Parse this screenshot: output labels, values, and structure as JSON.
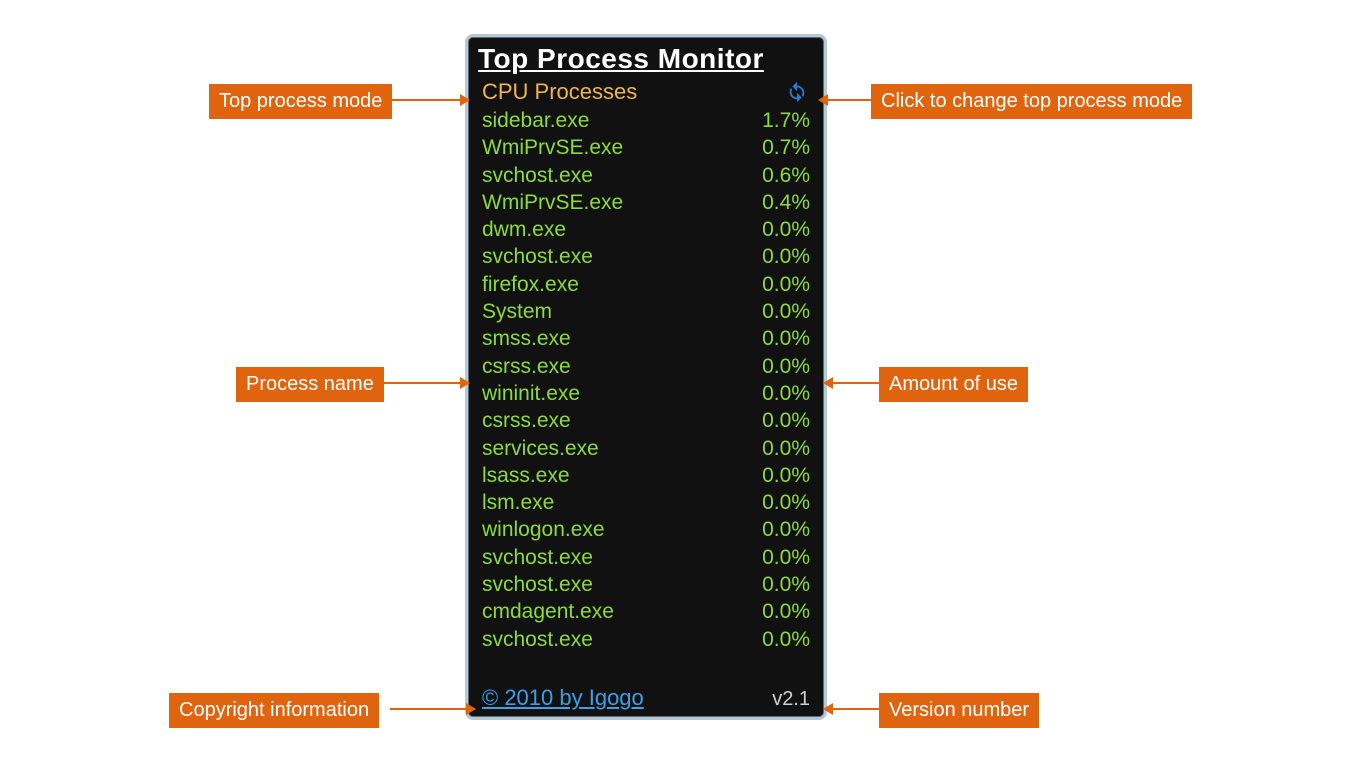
{
  "gadget": {
    "title": "Top Process Monitor",
    "mode_label": "CPU Processes",
    "refresh_icon": "refresh-icon",
    "processes": [
      {
        "name": "sidebar.exe",
        "value": "1.7%"
      },
      {
        "name": "WmiPrvSE.exe",
        "value": "0.7%"
      },
      {
        "name": "svchost.exe",
        "value": "0.6%"
      },
      {
        "name": "WmiPrvSE.exe",
        "value": "0.4%"
      },
      {
        "name": "dwm.exe",
        "value": "0.0%"
      },
      {
        "name": "svchost.exe",
        "value": "0.0%"
      },
      {
        "name": "firefox.exe",
        "value": "0.0%"
      },
      {
        "name": "System",
        "value": "0.0%"
      },
      {
        "name": "smss.exe",
        "value": "0.0%"
      },
      {
        "name": "csrss.exe",
        "value": "0.0%"
      },
      {
        "name": "wininit.exe",
        "value": "0.0%"
      },
      {
        "name": "csrss.exe",
        "value": "0.0%"
      },
      {
        "name": "services.exe",
        "value": "0.0%"
      },
      {
        "name": "lsass.exe",
        "value": "0.0%"
      },
      {
        "name": "lsm.exe",
        "value": "0.0%"
      },
      {
        "name": "winlogon.exe",
        "value": "0.0%"
      },
      {
        "name": "svchost.exe",
        "value": "0.0%"
      },
      {
        "name": "svchost.exe",
        "value": "0.0%"
      },
      {
        "name": "cmdagent.exe",
        "value": "0.0%"
      },
      {
        "name": "svchost.exe",
        "value": "0.0%"
      }
    ],
    "footer": {
      "copyright": "© 2010 by Igogo",
      "version": "v2.1"
    }
  },
  "callouts": {
    "mode": "Top process mode",
    "refresh": "Click to change top process mode",
    "proc_name": "Process name",
    "amount": "Amount of use",
    "copyright": "Copyright information",
    "version": "Version number"
  }
}
